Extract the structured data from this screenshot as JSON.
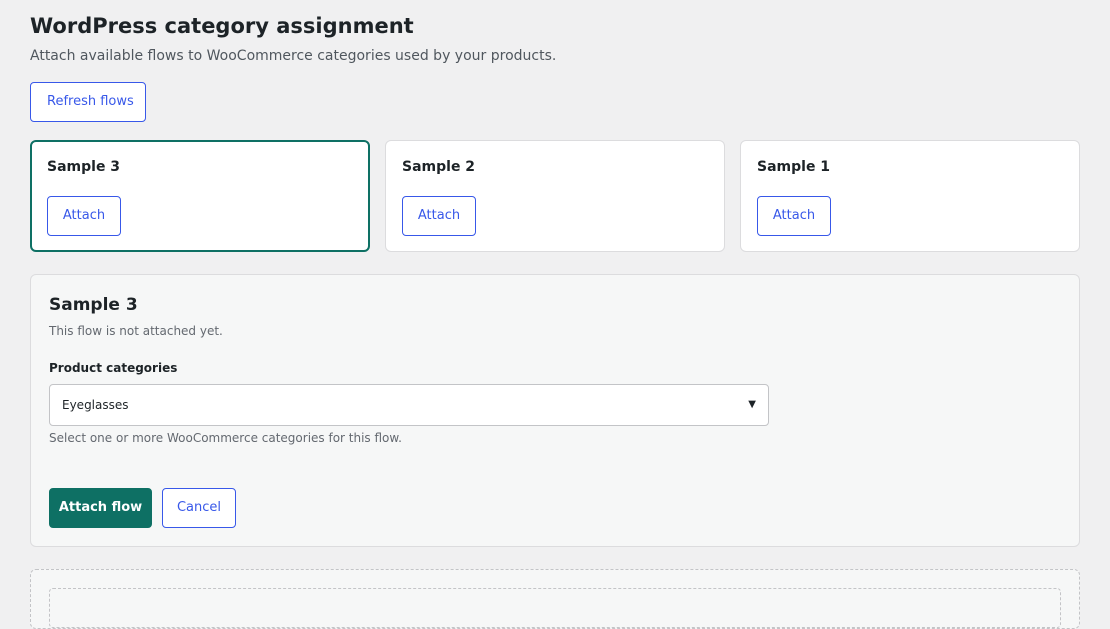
{
  "header": {
    "title": "WordPress category assignment",
    "subtitle": "Attach available flows to WooCommerce categories used by your products."
  },
  "toolbar": {
    "refresh_label": "Refresh flows"
  },
  "flows": [
    {
      "name": "Sample 3",
      "action_label": "Attach",
      "selected": true
    },
    {
      "name": "Sample 2",
      "action_label": "Attach",
      "selected": false
    },
    {
      "name": "Sample 1",
      "action_label": "Attach",
      "selected": false
    }
  ],
  "detail": {
    "title": "Sample 3",
    "status": "This flow is not attached yet.",
    "categories_label": "Product categories",
    "categories_selected": "Eyeglasses",
    "categories_help": "Select one or more WooCommerce categories for this flow.",
    "submit_label": "Attach flow",
    "cancel_label": "Cancel"
  },
  "icons": {
    "select_caret": "caret-down-icon",
    "caret_glyph": "▼"
  },
  "colors": {
    "accent": "#3858e9",
    "primary": "#0e7064",
    "background": "#f0f0f1"
  }
}
